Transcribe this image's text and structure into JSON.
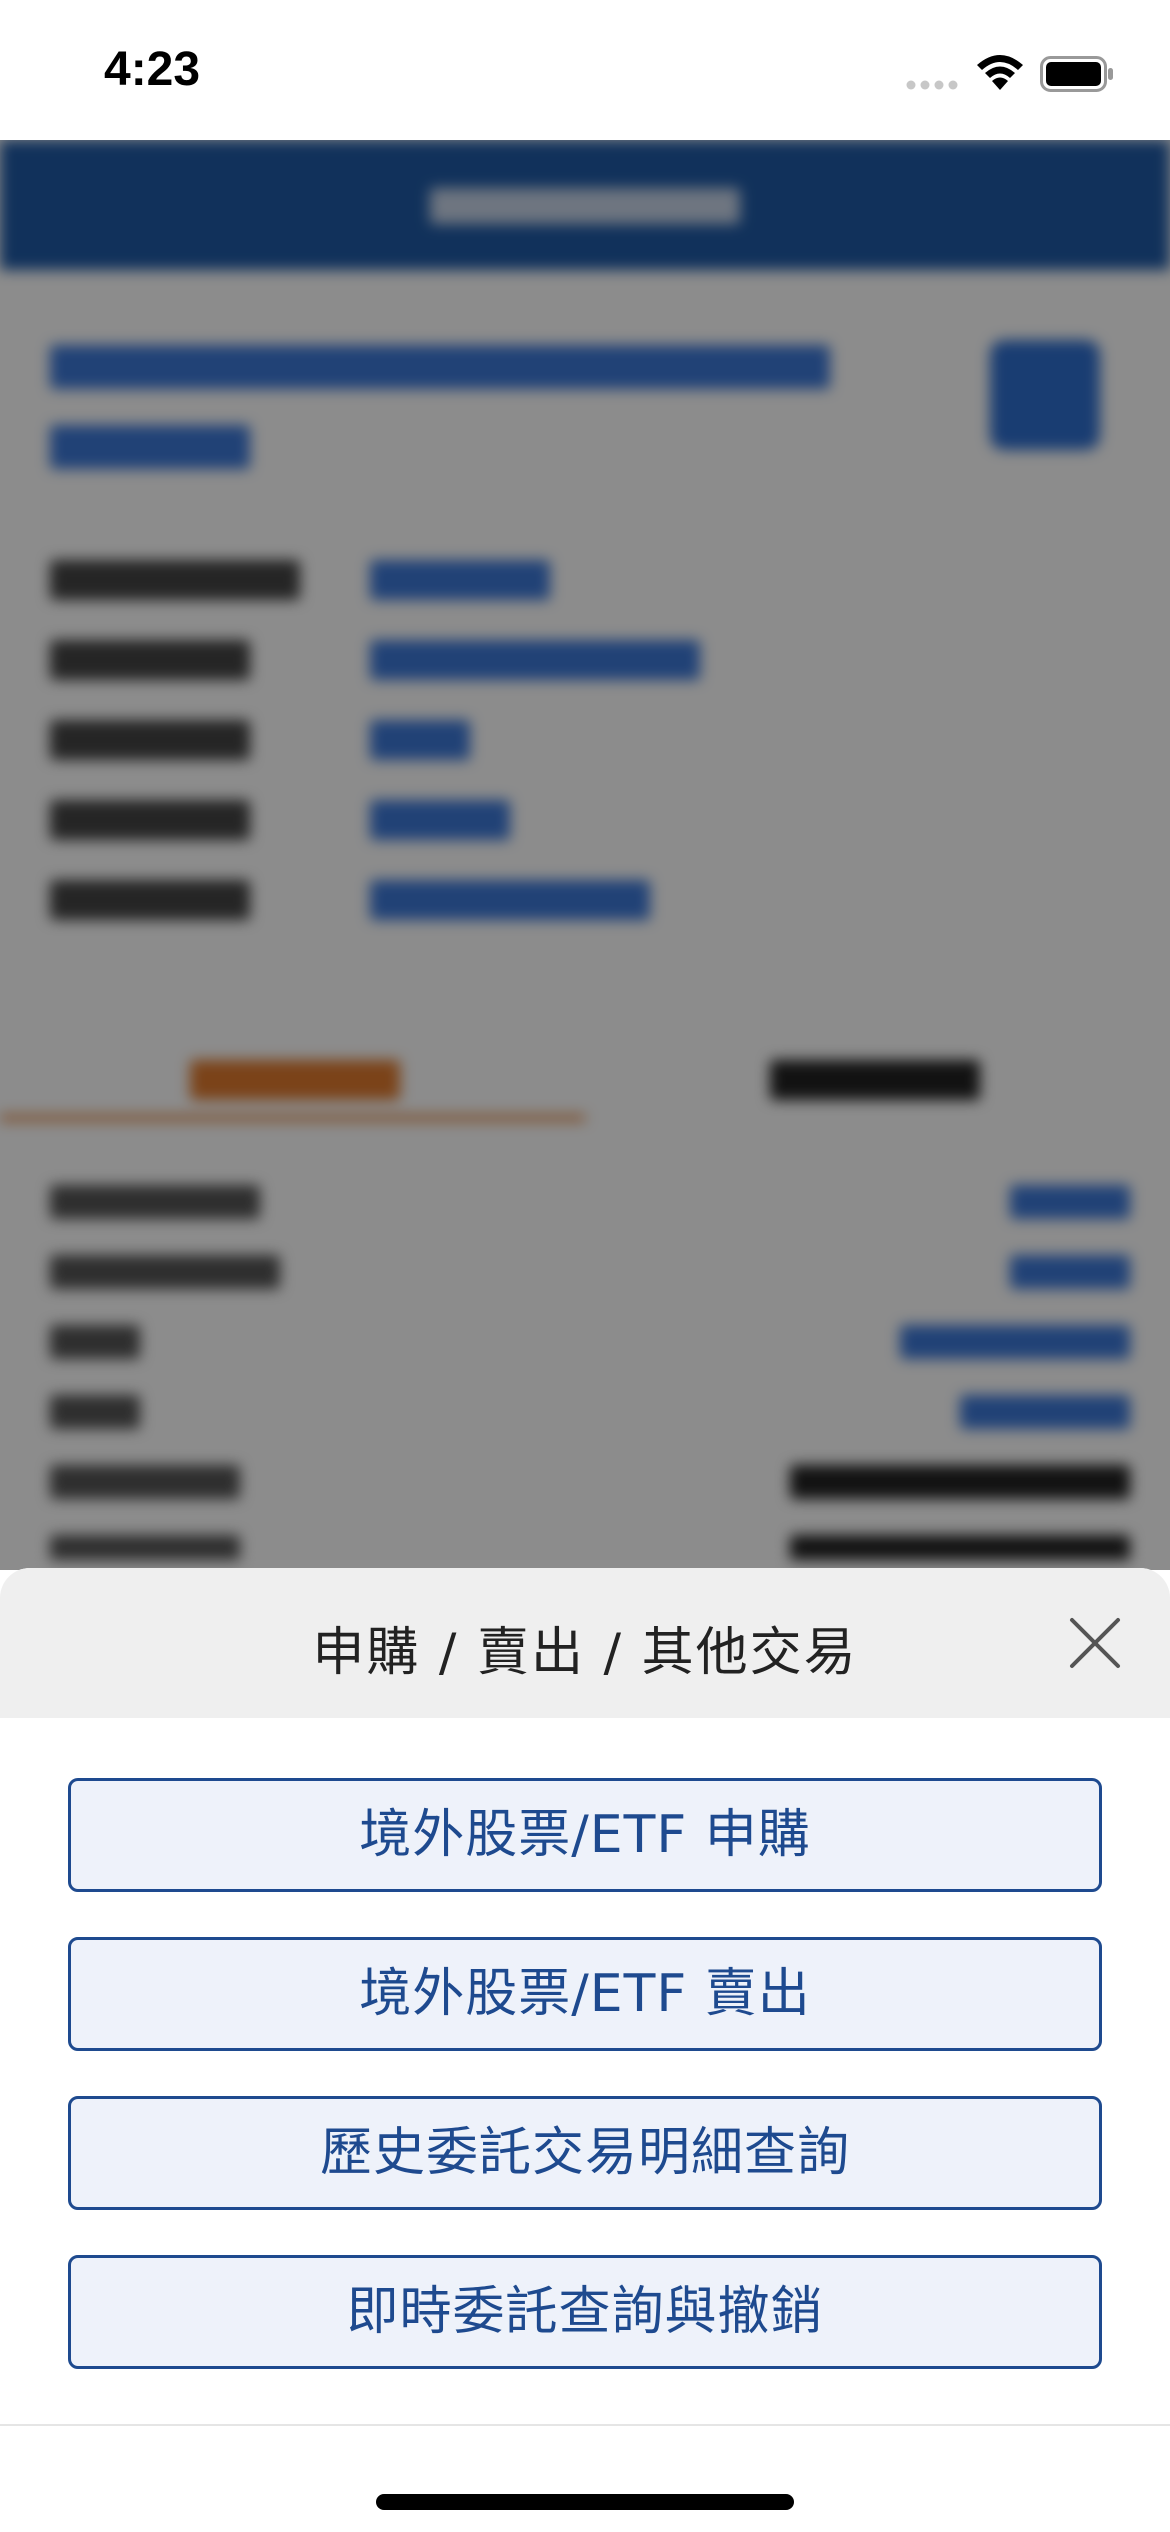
{
  "status_bar": {
    "time": "4:23"
  },
  "sheet": {
    "title": "申購 / 賣出 / 其他交易",
    "actions": [
      {
        "label": "境外股票/ETF 申購"
      },
      {
        "label": "境外股票/ETF 賣出"
      },
      {
        "label": "歷史委託交易明細查詢"
      },
      {
        "label": "即時委託查詢與撤銷"
      }
    ],
    "close_icon": "close-icon"
  },
  "colors": {
    "accent": "#1e4a8f",
    "button_fill": "#eef2fa",
    "sheet_header": "#efefef",
    "app_header": "#1f5aa6"
  }
}
